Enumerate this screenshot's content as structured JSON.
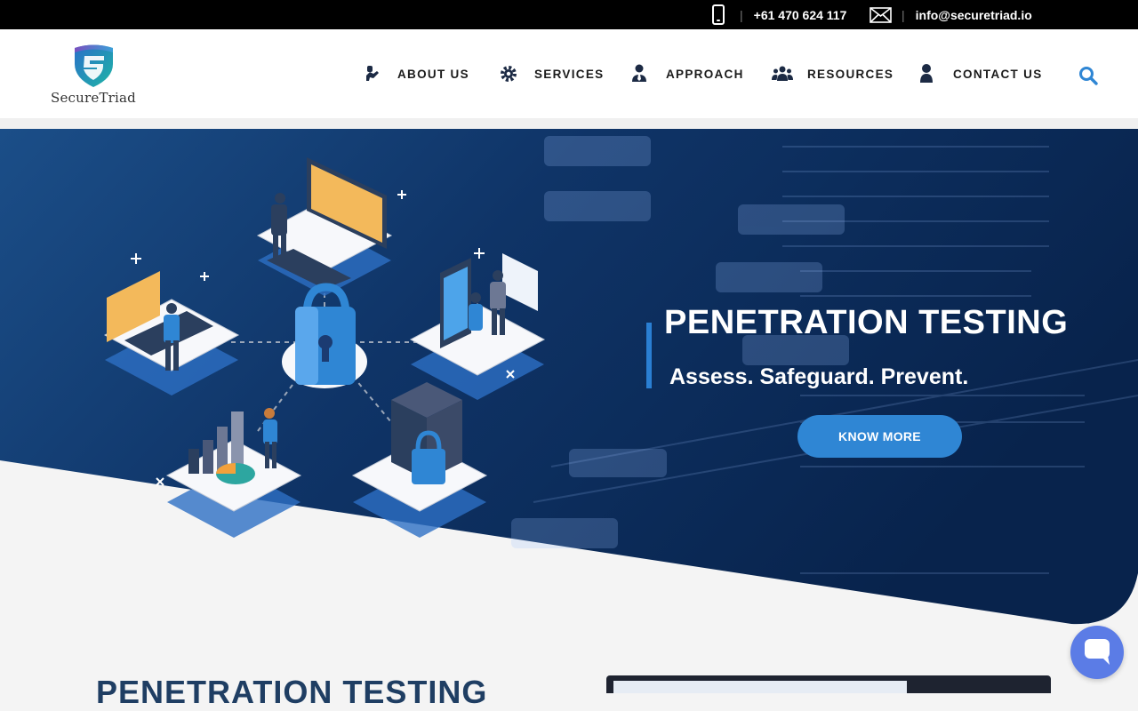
{
  "topbar": {
    "phone": "+61 470 624 117",
    "email": "info@securetriad.io",
    "separator": "|"
  },
  "brand": {
    "name": "SecureTriad"
  },
  "nav": {
    "items": [
      {
        "label": "ABOUT US",
        "icon": "handshake-icon"
      },
      {
        "label": "SERVICES",
        "icon": "gear-icon"
      },
      {
        "label": "APPROACH",
        "icon": "user-tie-icon"
      },
      {
        "label": "RESOURCES",
        "icon": "users-icon"
      },
      {
        "label": "CONTACT US",
        "icon": "user-icon"
      }
    ],
    "search_icon": "search-icon"
  },
  "hero": {
    "title": "PENETRATION TESTING",
    "subtitle": "Assess. Safeguard. Prevent.",
    "cta": "KNOW MORE"
  },
  "section": {
    "title": "PENETRATION TESTING"
  },
  "colors": {
    "accent": "#2f86d4",
    "navy": "#0d2a52",
    "heading": "#1f3e63",
    "chat": "#5b7ce6"
  }
}
